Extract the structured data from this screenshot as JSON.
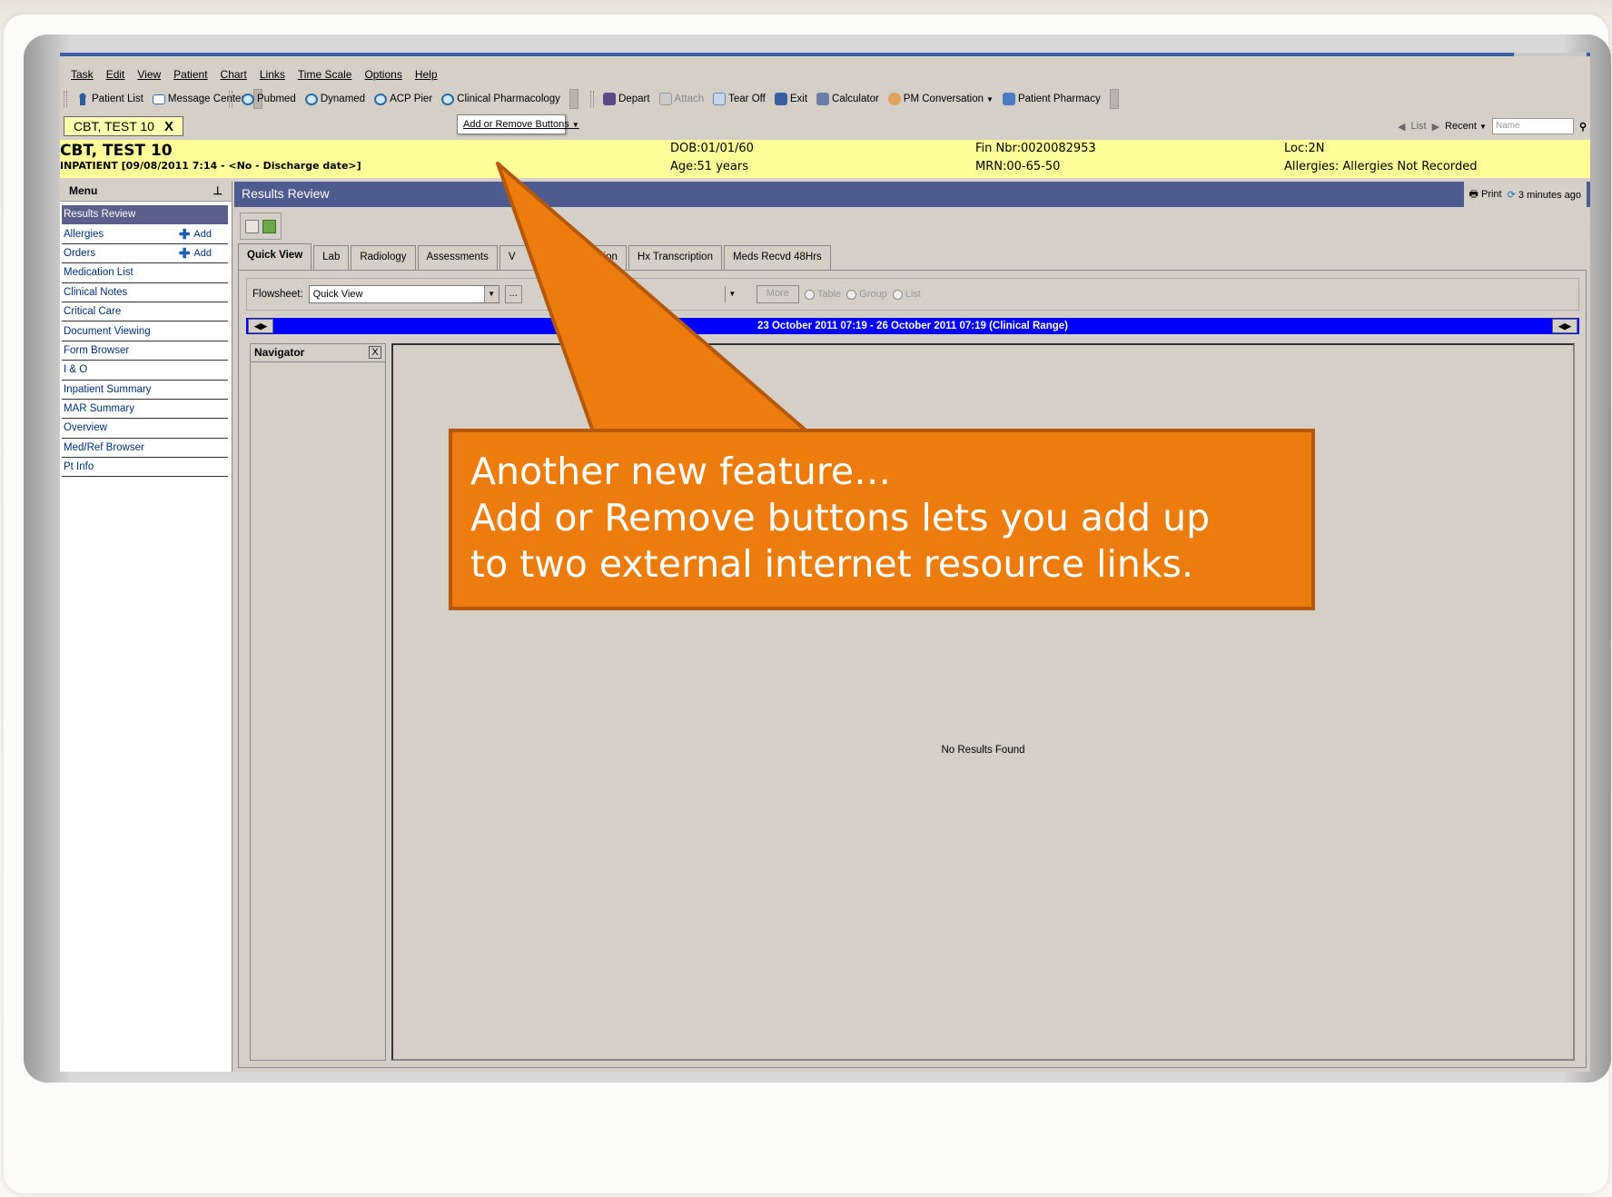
{
  "menubar": [
    "Task",
    "Edit",
    "View",
    "Patient",
    "Chart",
    "Links",
    "Time Scale",
    "Options",
    "Help"
  ],
  "toolbar": {
    "group1": [
      {
        "label": "Patient List",
        "icon": "person-icon"
      },
      {
        "label": "Message Center",
        "icon": "mail-icon"
      }
    ],
    "group2": [
      {
        "label": "Pubmed",
        "icon": "search-icon"
      },
      {
        "label": "Dynamed",
        "icon": "search-icon"
      },
      {
        "label": "ACP Pier",
        "icon": "search-icon"
      },
      {
        "label": "Clinical Pharmacology",
        "icon": "search-icon"
      }
    ],
    "group3": [
      {
        "label": "Depart",
        "icon": "door-icon"
      },
      {
        "label": "Attach",
        "icon": "attach-icon"
      },
      {
        "label": "Tear Off",
        "icon": "tear-off-icon"
      },
      {
        "label": "Exit",
        "icon": "exit-icon"
      },
      {
        "label": "Calculator",
        "icon": "calculator-icon"
      },
      {
        "label": "PM Conversation",
        "icon": "pm-icon"
      },
      {
        "label": "Patient Pharmacy",
        "icon": "pharmacy-icon"
      }
    ],
    "add_remove": "Add or Remove Buttons"
  },
  "patient_tab": {
    "name": "CBT, TEST 10",
    "close": "X"
  },
  "nav_right": {
    "list": "List",
    "recent": "Recent",
    "name_placeholder": "Name"
  },
  "banner": {
    "name": "CBT, TEST 10",
    "encounter": "INPATIENT [09/08/2011 7:14 - <No - Discharge date>]",
    "dob": "DOB:01/01/60",
    "age": "Age:51 years",
    "fin": "Fin Nbr:0020082953",
    "mrn": "MRN:00-65-50",
    "loc": "Loc:2N",
    "allergies": "Allergies: Allergies Not Recorded"
  },
  "sidebar": {
    "title": "Menu",
    "items": [
      {
        "label": "Results Review",
        "add": ""
      },
      {
        "label": "Allergies",
        "add": "Add"
      },
      {
        "label": "Orders",
        "add": "Add"
      },
      {
        "label": "Medication List",
        "add": ""
      },
      {
        "label": "Clinical Notes",
        "add": ""
      },
      {
        "label": "Critical Care",
        "add": ""
      },
      {
        "label": "Document Viewing",
        "add": ""
      },
      {
        "label": "Form Browser",
        "add": ""
      },
      {
        "label": "I & O",
        "add": ""
      },
      {
        "label": "Inpatient Summary",
        "add": ""
      },
      {
        "label": "MAR Summary",
        "add": ""
      },
      {
        "label": "Overview",
        "add": ""
      },
      {
        "label": "Med/Ref Browser",
        "add": ""
      },
      {
        "label": "Pt Info",
        "add": ""
      }
    ]
  },
  "results_review": {
    "title": "Results Review",
    "print": "Print",
    "updated": "3 minutes ago",
    "tabs": [
      "Quick View",
      "Lab",
      "Radiology",
      "Assessments",
      "V",
      "ription",
      "Hx Transcription",
      "Meds Recvd 48Hrs"
    ],
    "flowsheet_label": "Flowsheet:",
    "flowsheet_value": "Quick View",
    "ellipsis": "...",
    "more": "More",
    "radios": [
      "Table",
      "Group",
      "List"
    ],
    "range": "23 October 2011 07:19 - 26 October 2011 07:19 (Clinical Range)",
    "navigator": "Navigator",
    "navigator_close": "X",
    "no_results": "No Results Found"
  },
  "callout": {
    "line1": "Another new feature…",
    "line2": "Add or Remove buttons lets you add up",
    "line3": "to two external internet resource links.",
    "fill": "#ec7c0e",
    "border": "#b5580b"
  }
}
